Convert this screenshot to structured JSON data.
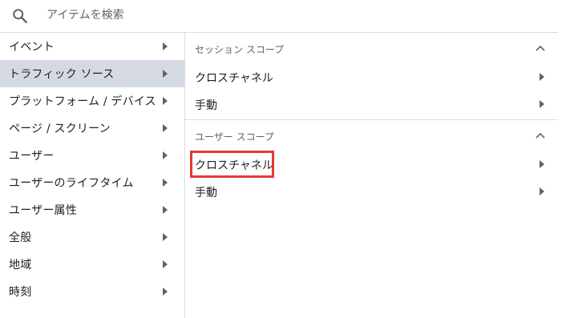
{
  "search": {
    "placeholder": "アイテムを検索"
  },
  "categories": [
    {
      "label": "イベント"
    },
    {
      "label": "トラフィック ソース"
    },
    {
      "label": "プラットフォーム / デバイス"
    },
    {
      "label": "ページ / スクリーン"
    },
    {
      "label": "ユーザー"
    },
    {
      "label": "ユーザーのライフタイム"
    },
    {
      "label": "ユーザー属性"
    },
    {
      "label": "全般"
    },
    {
      "label": "地域"
    },
    {
      "label": "時刻"
    }
  ],
  "sections": [
    {
      "title": "セッション スコープ",
      "items": [
        {
          "label": "クロスチャネル"
        },
        {
          "label": "手動"
        }
      ]
    },
    {
      "title": "ユーザー スコープ",
      "items": [
        {
          "label": "クロスチャネル"
        },
        {
          "label": "手動"
        }
      ]
    }
  ],
  "colors": {
    "active_bg": "#d4d9e3",
    "highlight": "#e53935",
    "divider": "#dadce0"
  }
}
